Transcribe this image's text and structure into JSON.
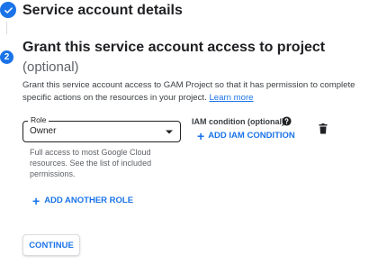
{
  "steps": {
    "completed": {
      "title": "Service account details",
      "icon": "check-icon"
    },
    "current": {
      "number": "2",
      "title": "Grant this service account access to project",
      "optional": "(optional)",
      "description": "Grant this service account access to GAM Project so that it has permission to complete specific actions on the resources in your project.",
      "learn_more": "Learn more"
    }
  },
  "role": {
    "label": "Role",
    "value": "Owner",
    "hint": "Full access to most Google Cloud resources. See the list of included permissions."
  },
  "iam": {
    "label": "IAM condition (optional)",
    "add_label": "ADD IAM CONDITION"
  },
  "actions": {
    "add_role_label": "ADD ANOTHER ROLE",
    "continue_label": "CONTINUE"
  },
  "colors": {
    "accent": "#1a73e8",
    "text": "#202124",
    "muted": "#5f6368"
  }
}
